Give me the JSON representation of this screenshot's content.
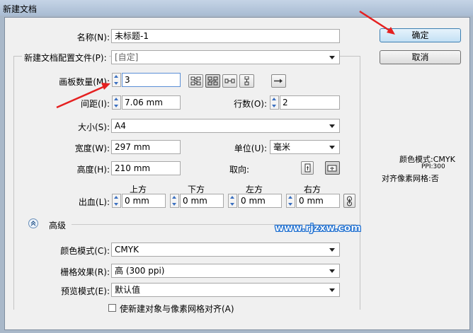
{
  "window": {
    "title": "新建文档"
  },
  "labels": {
    "name": "名称(N):",
    "profile": "新建文档配置文件(P):",
    "artboards": "画板数量(M):",
    "spacing": "间距(I):",
    "rows": "行数(O):",
    "size": "大小(S):",
    "width": "宽度(W):",
    "units": "单位(U):",
    "height": "高度(H):",
    "orientation": "取向:",
    "bleed": "出血(L):",
    "top": "上方",
    "bottom": "下方",
    "left": "左方",
    "right": "右方",
    "advanced": "高级",
    "color_mode": "颜色模式(C):",
    "raster": "栅格效果(R):",
    "preview": "预览模式(E):",
    "align_check": "使新建对象与像素网格对齐(A)"
  },
  "values": {
    "name": "未标题-1",
    "profile": "[自定]",
    "artboards": "3",
    "spacing": "7.06 mm",
    "rows": "2",
    "size": "A4",
    "width": "297 mm",
    "units": "毫米",
    "height": "210 mm",
    "bleed_top": "0 mm",
    "bleed_bottom": "0 mm",
    "bleed_left": "0 mm",
    "bleed_right": "0 mm",
    "color_mode": "CMYK",
    "raster": "高 (300 ppi)",
    "preview": "默认值",
    "align_checked": false
  },
  "buttons": {
    "ok": "确定",
    "cancel": "取消"
  },
  "info": {
    "color_mode": "颜色模式:CMYK",
    "ppi": "PPI:300",
    "align": "对齐像素网格:否"
  },
  "watermark": "www.rjzxw.com",
  "colors": {
    "accent": "#3c7fb1",
    "annotation": "#e52020"
  }
}
